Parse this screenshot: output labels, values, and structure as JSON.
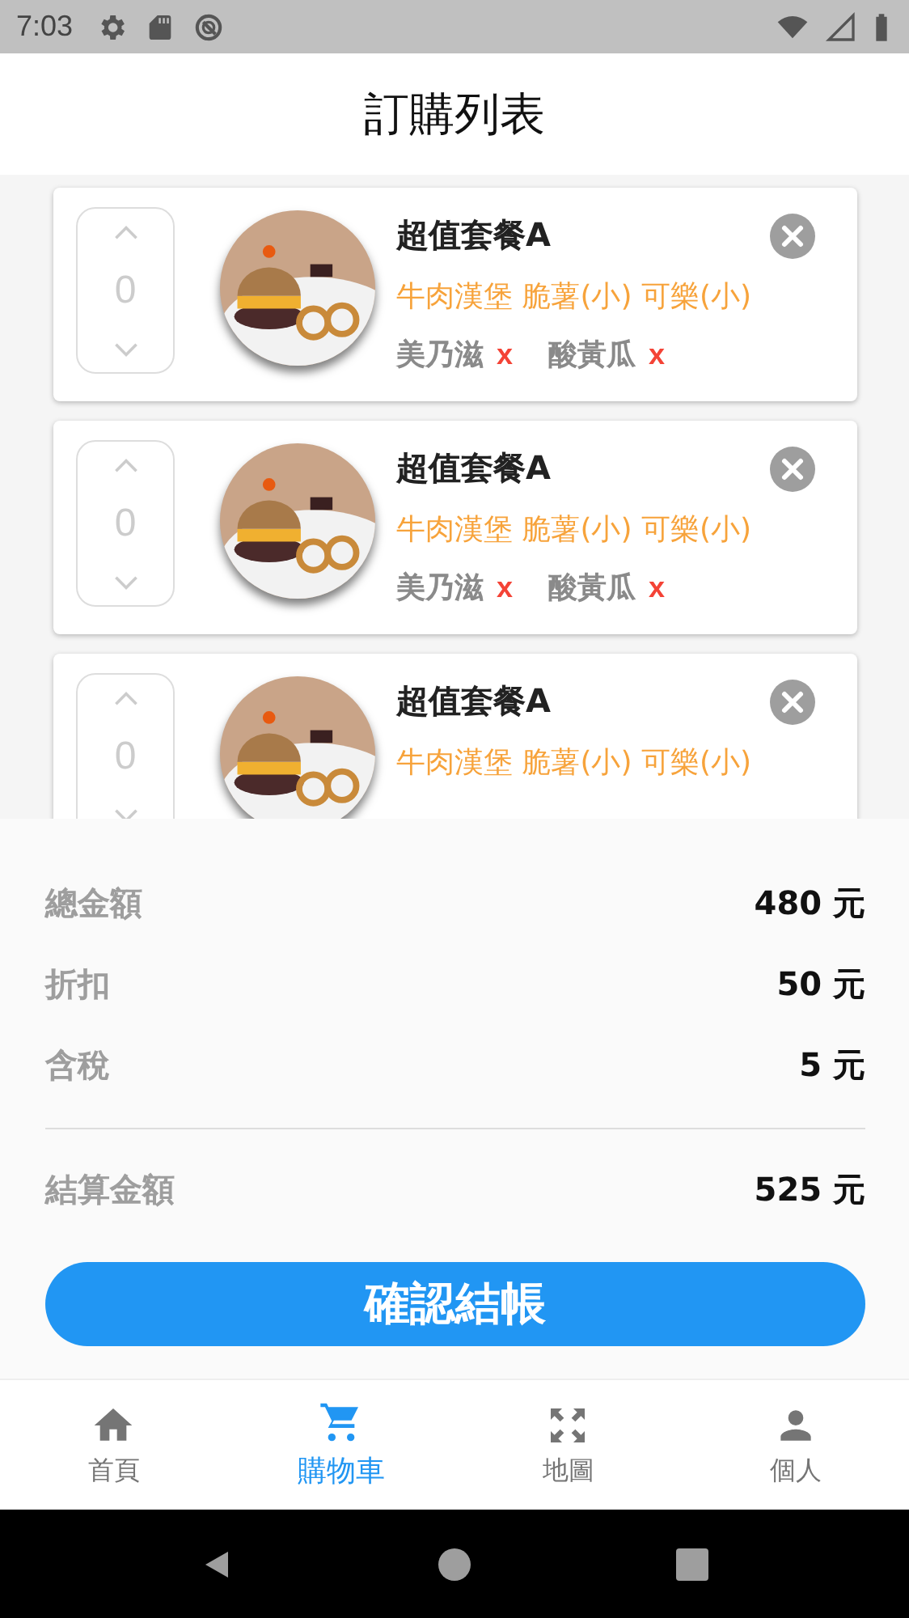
{
  "status_bar": {
    "time": "7:03"
  },
  "header": {
    "title": "訂購列表"
  },
  "cart_items": [
    {
      "quantity": "0",
      "name": "超值套餐A",
      "contents": "牛肉漢堡 脆薯(小) 可樂(小)",
      "toppings": [
        {
          "label": "美乃滋",
          "remove": "x"
        },
        {
          "label": "酸黃瓜",
          "remove": "x"
        }
      ]
    },
    {
      "quantity": "0",
      "name": "超值套餐A",
      "contents": "牛肉漢堡 脆薯(小) 可樂(小)",
      "toppings": [
        {
          "label": "美乃滋",
          "remove": "x"
        },
        {
          "label": "酸黃瓜",
          "remove": "x"
        }
      ]
    },
    {
      "quantity": "0",
      "name": "超值套餐A",
      "contents": "牛肉漢堡 脆薯(小) 可樂(小)"
    }
  ],
  "summary": {
    "rows": [
      {
        "label": "總金額",
        "value": "480 元"
      },
      {
        "label": "折扣",
        "value": "50 元"
      },
      {
        "label": "含稅",
        "value": "5 元"
      }
    ],
    "total": {
      "label": "結算金額",
      "value": "525 元"
    }
  },
  "checkout_button": "確認結帳",
  "bottom_nav": [
    {
      "kind": "home",
      "label": "首頁",
      "selected": false
    },
    {
      "kind": "cart",
      "label": "購物車",
      "selected": true
    },
    {
      "kind": "map",
      "label": "地圖",
      "selected": false
    },
    {
      "kind": "person",
      "label": "個人",
      "selected": false
    }
  ]
}
